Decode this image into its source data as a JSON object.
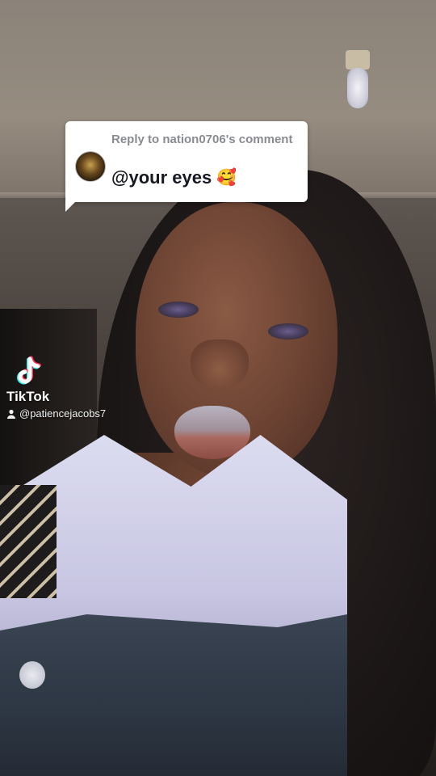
{
  "reply": {
    "header": "Reply to nation0706's comment",
    "comment_text": "@your eyes",
    "emoji": "🥰"
  },
  "watermark": {
    "brand": "TikTok",
    "handle": "@patiencejacobs7"
  },
  "colors": {
    "bubble_bg": "#ffffff",
    "header_text": "#8a8b91",
    "comment_text": "#161823",
    "tiktok_cyan": "#25f4ee",
    "tiktok_pink": "#fe2c55"
  }
}
